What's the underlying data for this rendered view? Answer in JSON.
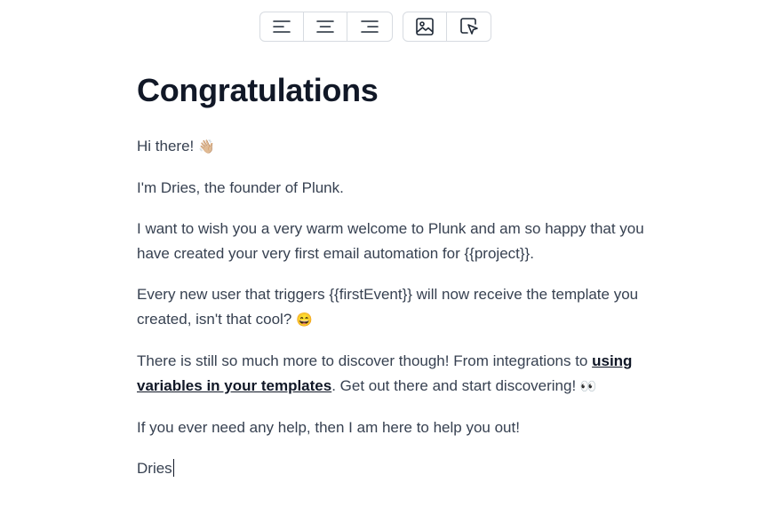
{
  "toolbar": {
    "align_group": [
      {
        "name": "align-left",
        "icon": "align-left-icon"
      },
      {
        "name": "align-center",
        "icon": "align-center-icon"
      },
      {
        "name": "align-right",
        "icon": "align-right-icon"
      }
    ],
    "insert_group": [
      {
        "name": "insert-image",
        "icon": "image-icon"
      },
      {
        "name": "insert-button",
        "icon": "cursor-click-icon"
      }
    ]
  },
  "email": {
    "heading": "Congratulations",
    "p1_text": "Hi there! ",
    "p1_emoji": "👋🏼",
    "p2": "I'm Dries, the founder of Plunk.",
    "p3": "I want to wish you a very warm welcome to Plunk and am so happy that you have created your very first email automation for {{project}}.",
    "p4_text": "Every new user that triggers {{firstEvent}} will now receive the template you created, isn't that cool? ",
    "p4_emoji": "😄",
    "p5_before": "There is still so much more to discover though! From integrations to ",
    "p5_link": "using variables in your templates",
    "p5_after": ". Get out there and start discovering! ",
    "p5_emoji": "👀",
    "p6": "If you ever need any help, then I am here to help you out!",
    "signature": "Dries"
  },
  "colors": {
    "heading": "#111827",
    "body_text": "#374151",
    "border": "#d7dbe1"
  }
}
